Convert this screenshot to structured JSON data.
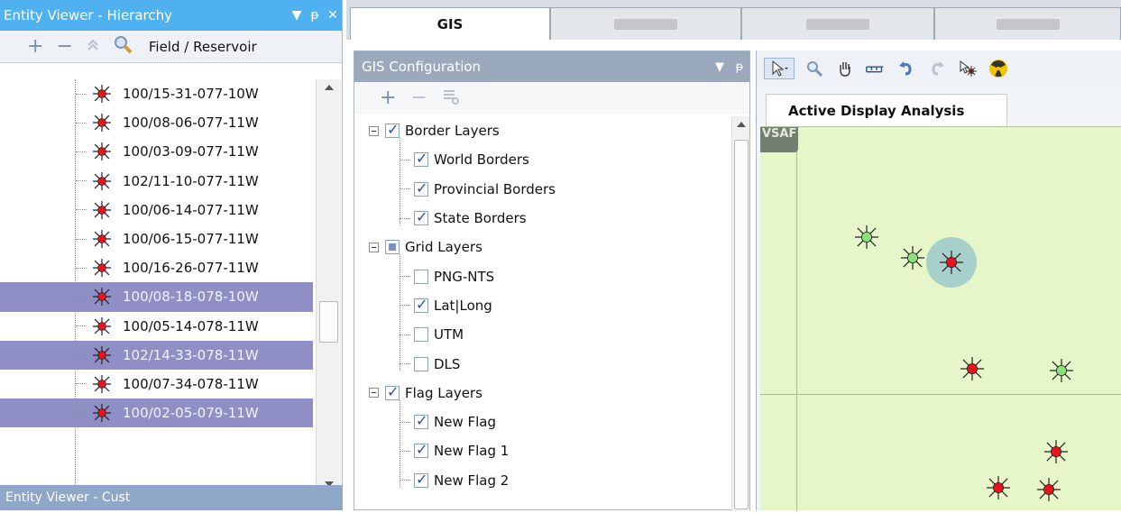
{
  "entity_viewer": {
    "title": "Entity Viewer - Hierarchy",
    "title_controls": [
      "▼",
      "ᵽ",
      "✕"
    ],
    "toolbar": {
      "add": "+",
      "remove": "−",
      "level_label": "Field / Reservoir"
    },
    "wells": [
      {
        "uwi": "100/15-31-077-10W",
        "selected": false
      },
      {
        "uwi": "100/08-06-077-11W",
        "selected": false
      },
      {
        "uwi": "100/03-09-077-11W",
        "selected": false
      },
      {
        "uwi": "102/11-10-077-11W",
        "selected": false
      },
      {
        "uwi": "100/06-14-077-11W",
        "selected": false
      },
      {
        "uwi": "100/06-15-077-11W",
        "selected": false
      },
      {
        "uwi": "100/16-26-077-11W",
        "selected": false
      },
      {
        "uwi": "100/08-18-078-10W",
        "selected": true
      },
      {
        "uwi": "100/05-14-078-11W",
        "selected": false
      },
      {
        "uwi": "102/14-33-078-11W",
        "selected": true
      },
      {
        "uwi": "100/07-34-078-11W",
        "selected": false
      },
      {
        "uwi": "100/02-05-079-11W",
        "selected": true
      }
    ],
    "bottom_title": "Entity Viewer - Cust"
  },
  "tabs": [
    {
      "label": "GIS",
      "active": true
    },
    {
      "label": "",
      "active": false
    },
    {
      "label": "",
      "active": false
    },
    {
      "label": "",
      "active": false
    }
  ],
  "gis_config": {
    "title": "GIS Configuration",
    "controls": [
      "▼",
      "ᵽ"
    ],
    "toolbar": {
      "add": "+",
      "remove": "−"
    },
    "tree": [
      {
        "label": "Border Layers",
        "level": 0,
        "state": "checked"
      },
      {
        "label": "World Borders",
        "level": 1,
        "state": "checked"
      },
      {
        "label": "Provincial Borders",
        "level": 1,
        "state": "checked"
      },
      {
        "label": "State Borders",
        "level": 1,
        "state": "checked"
      },
      {
        "label": "Grid Layers",
        "level": 0,
        "state": "partial"
      },
      {
        "label": "PNG-NTS",
        "level": 1,
        "state": "unchecked"
      },
      {
        "label": "Lat|Long",
        "level": 1,
        "state": "checked"
      },
      {
        "label": "UTM",
        "level": 1,
        "state": "unchecked"
      },
      {
        "label": "DLS",
        "level": 1,
        "state": "unchecked"
      },
      {
        "label": "Flag Layers",
        "level": 0,
        "state": "checked"
      },
      {
        "label": "New Flag",
        "level": 1,
        "state": "checked"
      },
      {
        "label": "New Flag 1",
        "level": 1,
        "state": "checked"
      },
      {
        "label": "New Flag 2",
        "level": 1,
        "state": "checked"
      }
    ]
  },
  "map": {
    "toolbar_icons": [
      "pointer-icon",
      "zoom-icon",
      "pan-hand-icon",
      "scale-bar-icon",
      "undo-icon",
      "redo-icon",
      "select-well-icon",
      "radiation-icon"
    ],
    "tab_label": "Active Display Analysis",
    "corner_label": "VSAF",
    "colors": {
      "background": "#e6f6c8",
      "well_red": "#e8141c",
      "well_green": "#8be07e",
      "halo": "#a6d0c9"
    },
    "wells": [
      {
        "status": "green",
        "selected": false
      },
      {
        "status": "green",
        "selected": false
      },
      {
        "status": "red",
        "selected": true
      },
      {
        "status": "red",
        "selected": false
      },
      {
        "status": "green",
        "selected": false
      },
      {
        "status": "red",
        "selected": false
      },
      {
        "status": "red",
        "selected": false
      },
      {
        "status": "red",
        "selected": false
      }
    ]
  }
}
